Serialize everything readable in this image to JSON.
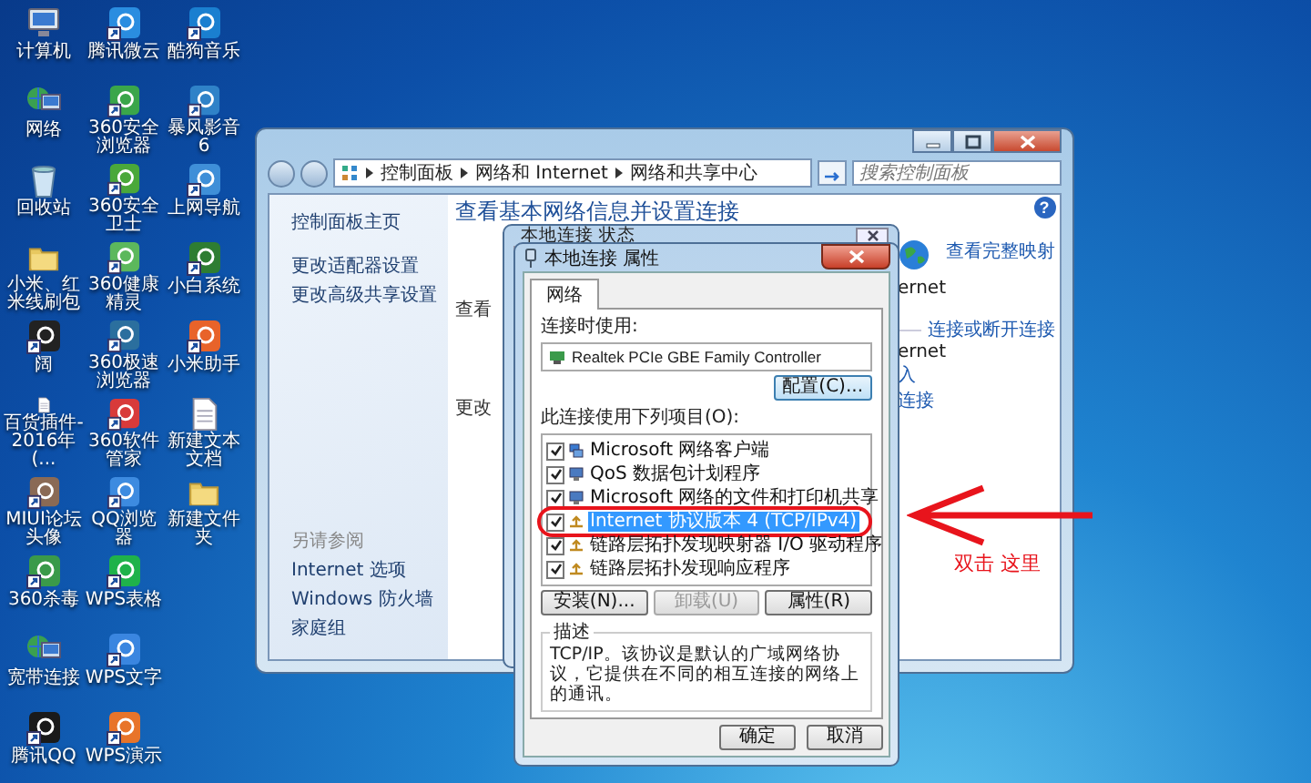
{
  "desktop_rows": [
    [
      {
        "label": "计算机",
        "kind": "computer"
      },
      {
        "label": "腾讯微云",
        "kind": "app",
        "color": "#2a8de0"
      },
      {
        "label": "酷狗音乐",
        "kind": "app",
        "color": "#1a7fd0"
      }
    ],
    [
      {
        "label": "网络",
        "kind": "network"
      },
      {
        "label": "360安全浏览器",
        "kind": "app",
        "color": "#3aa64a"
      },
      {
        "label": "暴风影音6",
        "kind": "app",
        "color": "#2f82c8"
      }
    ],
    [
      {
        "label": "回收站",
        "kind": "recycle-bin"
      },
      {
        "label": "360安全卫士",
        "kind": "app",
        "color": "#4aa83a"
      },
      {
        "label": "上网导航",
        "kind": "app",
        "color": "#3f8fd8"
      }
    ],
    [
      {
        "label": "小米、红米线刷包",
        "kind": "folder"
      },
      {
        "label": "360健康精灵",
        "kind": "app",
        "color": "#5cb85c"
      },
      {
        "label": "小白系统",
        "kind": "app",
        "color": "#2e7d32"
      }
    ],
    [
      {
        "label": "阔",
        "kind": "app",
        "color": "#222222"
      },
      {
        "label": "360极速浏览器",
        "kind": "app",
        "color": "#2b6f9e"
      },
      {
        "label": "小米助手",
        "kind": "app",
        "color": "#e8632a"
      }
    ],
    [
      {
        "label": "百货插件-2016年(...",
        "kind": "document"
      },
      {
        "label": "360软件管家",
        "kind": "app",
        "color": "#d83a3a"
      },
      {
        "label": "新建文本文档",
        "kind": "document"
      }
    ],
    [
      {
        "label": "MIUI论坛头像",
        "kind": "app",
        "color": "#8a6a55"
      },
      {
        "label": "QQ浏览器",
        "kind": "app",
        "color": "#3d8be0"
      },
      {
        "label": "新建文件夹",
        "kind": "folder"
      }
    ],
    [
      {
        "label": "360杀毒",
        "kind": "app",
        "color": "#3a9a4a"
      },
      {
        "label": "WPS表格",
        "kind": "app",
        "color": "#1fb24a"
      }
    ],
    [
      {
        "label": "宽带连接",
        "kind": "network"
      },
      {
        "label": "WPS文字",
        "kind": "app",
        "color": "#3a86e0"
      }
    ],
    [
      {
        "label": "腾讯QQ",
        "kind": "app",
        "color": "#1a1a1a"
      },
      {
        "label": "WPS演示",
        "kind": "app",
        "color": "#e8742a"
      }
    ]
  ],
  "control_panel": {
    "breadcrumb": [
      "控制面板",
      "网络和 Internet",
      "网络和共享中心"
    ],
    "search": {
      "placeholder": "搜索控制面板"
    },
    "sidebar": {
      "links": [
        "控制面板主页",
        "更改适配器设置",
        "更改高级共享设置"
      ],
      "see_also": {
        "title": "另请参阅",
        "links": [
          "Internet 选项",
          "Windows 防火墙",
          "家庭组"
        ]
      }
    },
    "heading": "查看基本网络信息并设置连接",
    "help": "?",
    "left_fragments": [
      "查看",
      "更改"
    ],
    "right": {
      "network_name_1": "ernet",
      "map_link": "查看完整映射",
      "connect_link": "连接或断开连接",
      "network_name_2": "ernet",
      "fragment_1": "入",
      "fragment_2": "连接"
    }
  },
  "status_dialog": {
    "title": "本地连接 状态"
  },
  "properties_dialog": {
    "title": "本地连接 属性",
    "tabs": [
      {
        "label": "网络",
        "selected": true
      }
    ],
    "connect_using_label": "连接时使用:",
    "adapter": "Realtek PCIe GBE Family Controller",
    "configure_button": "配置(C)...",
    "items_label": "此连接使用下列项目(O):",
    "items": [
      {
        "label": "Microsoft 网络客户端",
        "checked": true,
        "selected": false,
        "kind": "client"
      },
      {
        "label": "QoS 数据包计划程序",
        "checked": true,
        "selected": false,
        "kind": "service"
      },
      {
        "label": "Microsoft 网络的文件和打印机共享",
        "checked": true,
        "selected": false,
        "kind": "service"
      },
      {
        "label": "Internet 协议版本 4 (TCP/IPv4)",
        "checked": true,
        "selected": true,
        "kind": "protocol"
      },
      {
        "label": "链路层拓扑发现映射器 I/O 驱动程序",
        "checked": true,
        "selected": false,
        "kind": "protocol"
      },
      {
        "label": "链路层拓扑发现响应程序",
        "checked": true,
        "selected": false,
        "kind": "protocol"
      }
    ],
    "buttons": [
      {
        "label": "安装(N)...",
        "disabled": false
      },
      {
        "label": "卸载(U)",
        "disabled": true
      },
      {
        "label": "属性(R)",
        "disabled": false
      }
    ],
    "description": {
      "title": "描述",
      "text": "TCP/IP。该协议是默认的广域网络协议，它提供在不同的相互连接的网络上的通讯。"
    },
    "footer_buttons": [
      "确定",
      "取消"
    ]
  },
  "annotation": {
    "text": "双击 这里"
  }
}
